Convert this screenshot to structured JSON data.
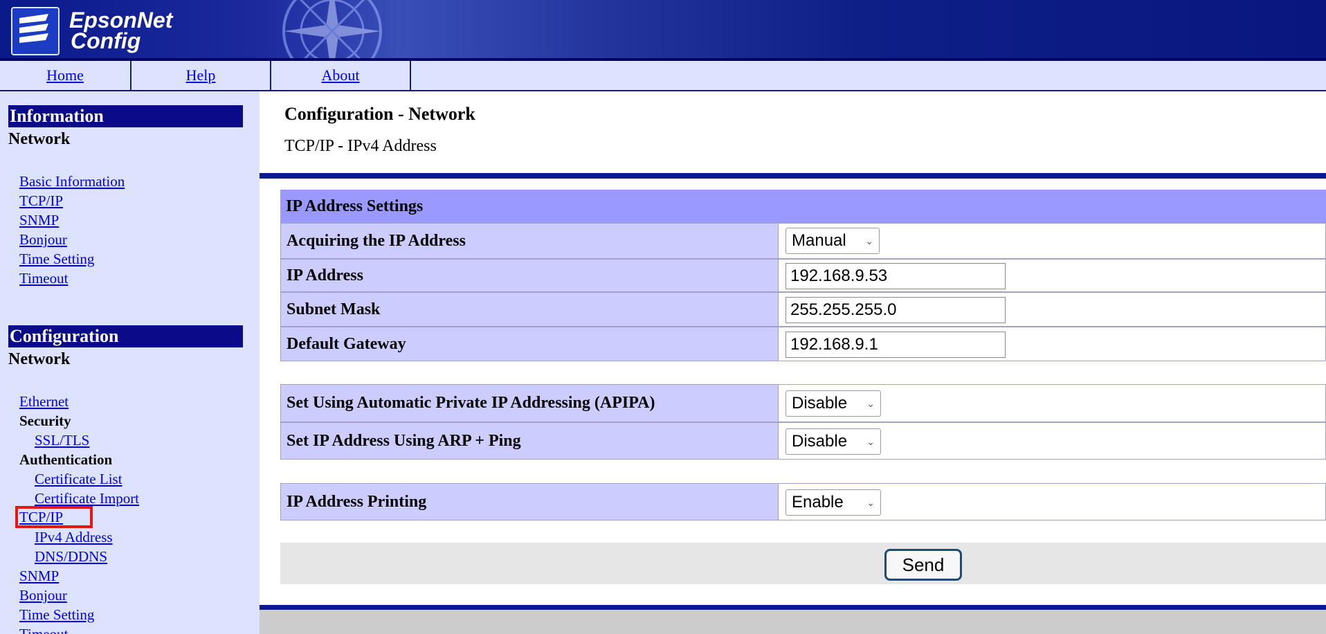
{
  "brand": {
    "line1": "EpsonNet",
    "line2": "Config"
  },
  "nav": {
    "home": "Home",
    "help": "Help",
    "about": "About"
  },
  "sidebar": {
    "info_heading": "Information",
    "info_network": "Network",
    "info_links": [
      "Basic Information",
      "TCP/IP",
      "SNMP",
      "Bonjour",
      "Time Setting",
      "Timeout"
    ],
    "config_heading": "Configuration",
    "config_network": "Network",
    "ethernet": "Ethernet",
    "security": "Security",
    "ssl_tls": "SSL/TLS",
    "authentication": "Authentication",
    "certificate_list": "Certificate List",
    "certificate_import": "Certificate Import",
    "tcpip": "TCP/IP",
    "ipv4": "IPv4 Address",
    "dns": "DNS/DDNS",
    "snmp": "SNMP",
    "bonjour": "Bonjour",
    "time_setting": "Time Setting",
    "timeout_partial": "Timeout"
  },
  "main": {
    "title": "Configuration - Network",
    "subtitle": "TCP/IP - IPv4 Address",
    "panel_heading": "IP Address Settings",
    "rows": {
      "acquiring": {
        "label": "Acquiring the IP Address",
        "value": "Manual"
      },
      "ip": {
        "label": "IP Address",
        "value": "192.168.9.53"
      },
      "subnet": {
        "label": "Subnet Mask",
        "value": "255.255.255.0"
      },
      "gateway": {
        "label": "Default Gateway",
        "value": "192.168.9.1"
      },
      "apipa": {
        "label": "Set Using Automatic Private IP Addressing (APIPA)",
        "value": "Disable"
      },
      "arp": {
        "label": "Set IP Address Using ARP + Ping",
        "value": "Disable"
      },
      "printing": {
        "label": "IP Address Printing",
        "value": "Enable"
      }
    },
    "send_label": "Send"
  },
  "colors": {
    "banner": "#0a1a8a",
    "nav_bg": "#dde3ff",
    "sidebar_heading": "#0b0b8a",
    "panel_heading": "#9999ff",
    "label_cell": "#ccccff",
    "highlight": "#e81515"
  },
  "icons": {
    "logo": "epson-logo-icon",
    "dropdown": "chevron-down-icon"
  }
}
